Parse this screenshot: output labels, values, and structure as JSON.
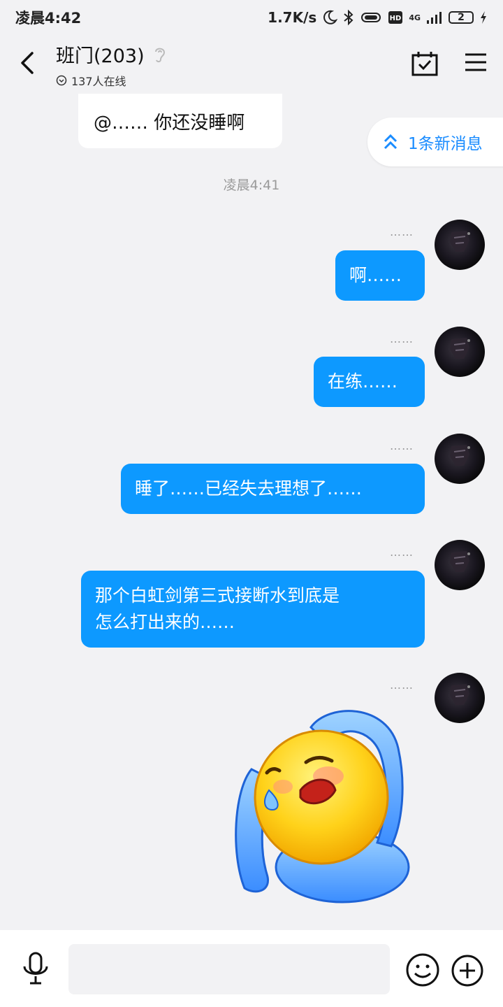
{
  "status_bar": {
    "time": "凌晨4:42",
    "net_speed": "1.7K/s",
    "network": "4G",
    "battery": "2"
  },
  "header": {
    "title": "班门(203)",
    "online": "137人在线"
  },
  "chat": {
    "incoming_partial": "@…… 你还没睡啊",
    "new_messages": "1条新消息",
    "timestamp": "凌晨4:41",
    "messages": [
      {
        "sender": "……",
        "text": "啊……"
      },
      {
        "sender": "……",
        "text": "在练……"
      },
      {
        "sender": "……",
        "text": "睡了……已经失去理想了……"
      },
      {
        "sender": "……",
        "line1": "那个白虹剑第三式接断水到底是",
        "line2": "怎么打出来的……"
      },
      {
        "sender": "……"
      }
    ]
  },
  "input_bar": {
    "placeholder": ""
  },
  "colors": {
    "accent": "#0d99ff",
    "background": "#f2f2f4"
  }
}
